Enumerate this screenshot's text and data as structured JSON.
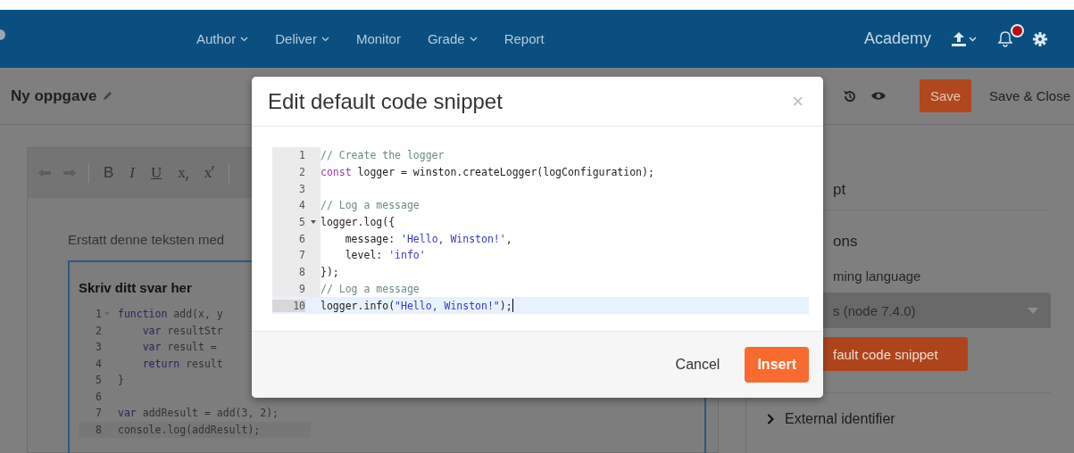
{
  "header": {
    "nav": [
      {
        "label": "Author",
        "dropdown": true
      },
      {
        "label": "Deliver",
        "dropdown": true
      },
      {
        "label": "Monitor",
        "dropdown": false
      },
      {
        "label": "Grade",
        "dropdown": true
      },
      {
        "label": "Report",
        "dropdown": false
      }
    ],
    "org": "Academy",
    "notification": true
  },
  "toolbar": {
    "title": "Ny oppgave",
    "save": "Save",
    "save_close": "Save & Close"
  },
  "editor": {
    "format_buttons": [
      {
        "label": "B",
        "kind": "bold"
      },
      {
        "label": "I",
        "kind": "italic"
      },
      {
        "label": "U",
        "kind": "underline"
      },
      {
        "label": "x",
        "kind": "subscript"
      },
      {
        "label": "x",
        "kind": "superscript"
      }
    ],
    "intro": "Erstatt denne teksten med",
    "answer_title": "Skriv ditt svar her",
    "code": [
      {
        "number": "1",
        "fold": true,
        "active": false,
        "tokens": [
          {
            "text": "function",
            "kind": "keyword"
          },
          {
            "text": " add(x, y",
            "kind": "plain"
          }
        ]
      },
      {
        "number": "2",
        "fold": false,
        "active": false,
        "tokens": [
          {
            "text": "    var",
            "kind": "keyword"
          },
          {
            "text": " resultStr",
            "kind": "plain"
          }
        ]
      },
      {
        "number": "3",
        "fold": false,
        "active": false,
        "tokens": [
          {
            "text": "    var",
            "kind": "keyword"
          },
          {
            "text": " result = ",
            "kind": "plain"
          }
        ]
      },
      {
        "number": "4",
        "fold": false,
        "active": false,
        "tokens": [
          {
            "text": "    return",
            "kind": "keyword"
          },
          {
            "text": " result",
            "kind": "plain"
          }
        ]
      },
      {
        "number": "5",
        "fold": false,
        "active": false,
        "tokens": [
          {
            "text": "}",
            "kind": "plain"
          }
        ]
      },
      {
        "number": "6",
        "fold": false,
        "active": false
      },
      {
        "number": "7",
        "fold": false,
        "active": false,
        "tokens": [
          {
            "text": "var",
            "kind": "keyword"
          },
          {
            "text": " addResult = add(3, 2);",
            "kind": "plain"
          }
        ]
      },
      {
        "number": "8",
        "fold": false,
        "active": true,
        "tokens": [
          {
            "text": "console.log(addResult);",
            "kind": "plain"
          }
        ]
      }
    ]
  },
  "side": {
    "script_label": "pt",
    "options_label": "ons",
    "language_label": "ming language",
    "language_value": "s (node 7.4.0)",
    "snippet_button": "fault code snippet",
    "external": "External identifier"
  },
  "dialog": {
    "title": "Edit default code snippet",
    "close": "×",
    "cancel": "Cancel",
    "insert": "Insert",
    "code": [
      {
        "number": "1",
        "fold": false,
        "active": false,
        "tokens": [
          {
            "text": "// Create the logger",
            "kind": "comment"
          }
        ]
      },
      {
        "number": "2",
        "fold": false,
        "active": false,
        "tokens": [
          {
            "text": "const",
            "kind": "keyword"
          },
          {
            "text": " logger = winston.createLogger(logConfiguration);",
            "kind": "plain"
          }
        ]
      },
      {
        "number": "3",
        "fold": false,
        "active": false
      },
      {
        "number": "4",
        "fold": false,
        "active": false,
        "tokens": [
          {
            "text": "// Log a message",
            "kind": "comment"
          }
        ]
      },
      {
        "number": "5",
        "fold": true,
        "active": false,
        "tokens": [
          {
            "text": "logger.log({",
            "kind": "plain"
          }
        ]
      },
      {
        "number": "6",
        "fold": false,
        "active": false,
        "tokens": [
          {
            "text": "    message: ",
            "kind": "plain"
          },
          {
            "text": "'Hello, Winston!'",
            "kind": "string"
          },
          {
            "text": ",",
            "kind": "plain"
          }
        ]
      },
      {
        "number": "7",
        "fold": false,
        "active": false,
        "tokens": [
          {
            "text": "    level: ",
            "kind": "plain"
          },
          {
            "text": "'info'",
            "kind": "string"
          }
        ]
      },
      {
        "number": "8",
        "fold": false,
        "active": false,
        "tokens": [
          {
            "text": "});",
            "kind": "plain"
          }
        ]
      },
      {
        "number": "9",
        "fold": false,
        "active": false,
        "tokens": [
          {
            "text": "// Log a message",
            "kind": "comment"
          }
        ]
      },
      {
        "number": "10",
        "fold": false,
        "active": true,
        "tokens": [
          {
            "text": "logger.info(",
            "kind": "plain"
          },
          {
            "text": "\"Hello, Winston!\"",
            "kind": "string"
          },
          {
            "text": ");",
            "kind": "plain"
          }
        ]
      }
    ]
  }
}
